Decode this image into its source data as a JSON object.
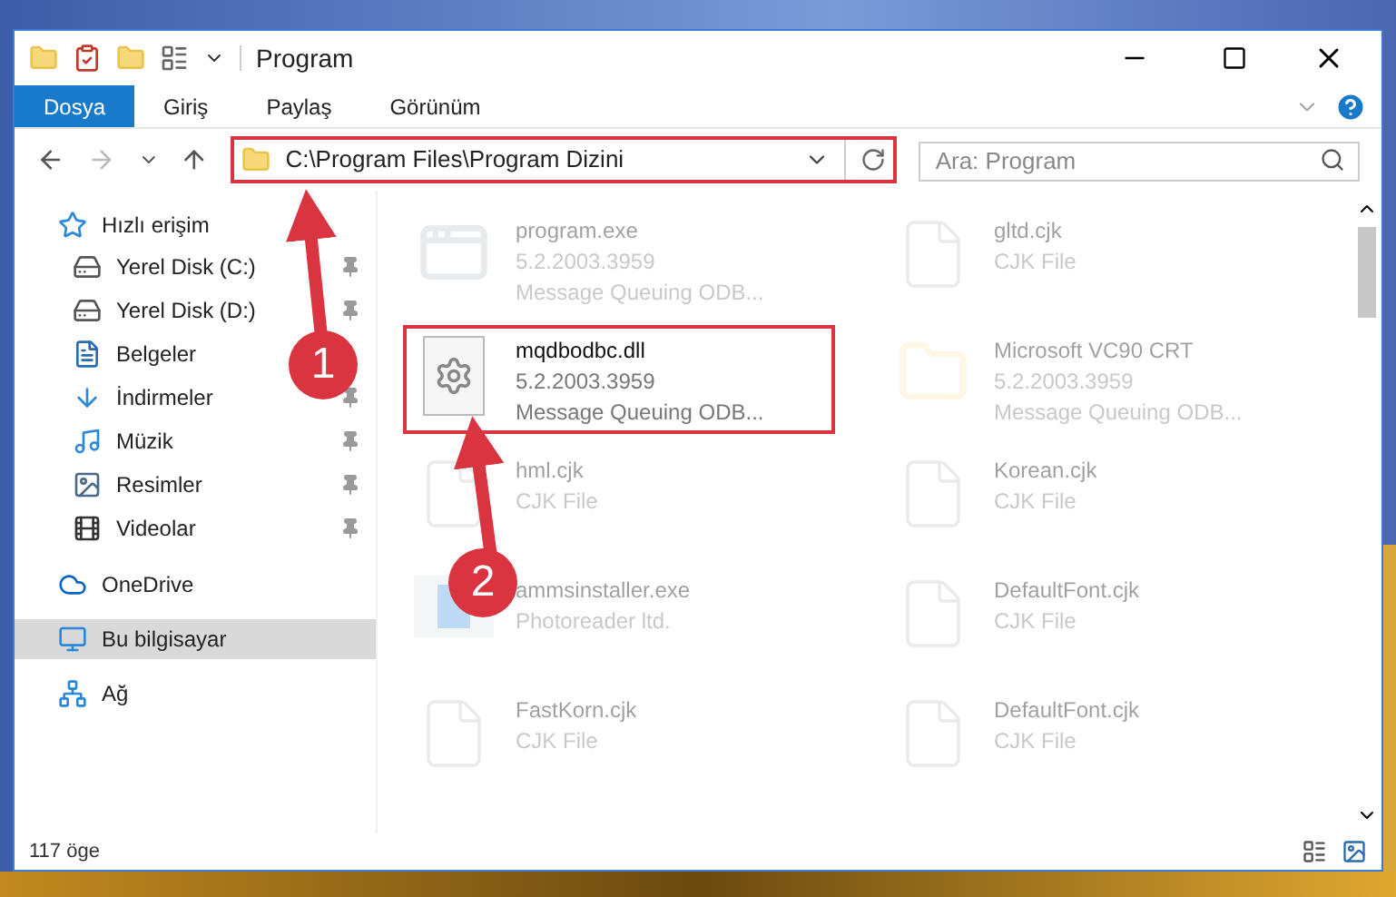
{
  "window": {
    "title": "Program"
  },
  "ribbon_tabs": [
    {
      "label": "Dosya",
      "selected": true
    },
    {
      "label": "Giriş",
      "selected": false
    },
    {
      "label": "Paylaş",
      "selected": false
    },
    {
      "label": "Görünüm",
      "selected": false
    }
  ],
  "address": {
    "path": "C:\\Program Files\\Program Dizini"
  },
  "search": {
    "placeholder": "Ara: Program"
  },
  "sidebar": {
    "items": [
      {
        "label": "Hızlı erişim",
        "kind": "star",
        "selected": false,
        "children": [
          {
            "label": "Yerel Disk (C:)",
            "kind": "drive",
            "pinned": true
          },
          {
            "label": "Yerel Disk (D:)",
            "kind": "drive",
            "pinned": true
          },
          {
            "label": "Belgeler",
            "kind": "doc",
            "pinned": false
          },
          {
            "label": "İndirmeler",
            "kind": "download",
            "pinned": true
          },
          {
            "label": "Müzik",
            "kind": "music",
            "pinned": true
          },
          {
            "label": "Resimler",
            "kind": "image",
            "pinned": true
          },
          {
            "label": "Videolar",
            "kind": "video",
            "pinned": true
          }
        ]
      },
      {
        "label": "OneDrive",
        "kind": "cloud",
        "selected": false
      },
      {
        "label": "Bu bilgisayar",
        "kind": "pc",
        "selected": true
      },
      {
        "label": "Ağ",
        "kind": "network",
        "selected": false
      }
    ]
  },
  "files": [
    {
      "name": "program.exe",
      "lines": [
        "5.2.2003.3959",
        "Message Queuing ODB..."
      ],
      "kind": "exe",
      "highlighted": false
    },
    {
      "name": "gltd.cjk",
      "lines": [
        "CJK File"
      ],
      "kind": "blank",
      "highlighted": false
    },
    {
      "name": "mqdbodbc.dll",
      "lines": [
        "5.2.2003.3959",
        "Message Queuing ODB..."
      ],
      "kind": "dll",
      "highlighted": true
    },
    {
      "name": "Microsoft VC90 CRT",
      "lines": [
        "5.2.2003.3959",
        "Message Queuing ODB..."
      ],
      "kind": "folder",
      "highlighted": false
    },
    {
      "name": "hml.cjk",
      "lines": [
        "CJK File"
      ],
      "kind": "blank",
      "highlighted": false
    },
    {
      "name": "Korean.cjk",
      "lines": [
        "CJK File"
      ],
      "kind": "blank",
      "highlighted": false
    },
    {
      "name": "ammsinstaller.exe",
      "lines": [
        "Photoreader ltd."
      ],
      "kind": "installer",
      "highlighted": false
    },
    {
      "name": "DefaultFont.cjk",
      "lines": [
        "CJK File"
      ],
      "kind": "blank",
      "highlighted": false
    },
    {
      "name": "FastKorn.cjk",
      "lines": [
        "CJK File"
      ],
      "kind": "blank",
      "highlighted": false
    },
    {
      "name": "DefaultFont.cjk",
      "lines": [
        "CJK File"
      ],
      "kind": "blank",
      "highlighted": false
    }
  ],
  "status_bar": {
    "count": "117 öge"
  },
  "annotations": [
    {
      "number": "1"
    },
    {
      "number": "2"
    }
  ]
}
